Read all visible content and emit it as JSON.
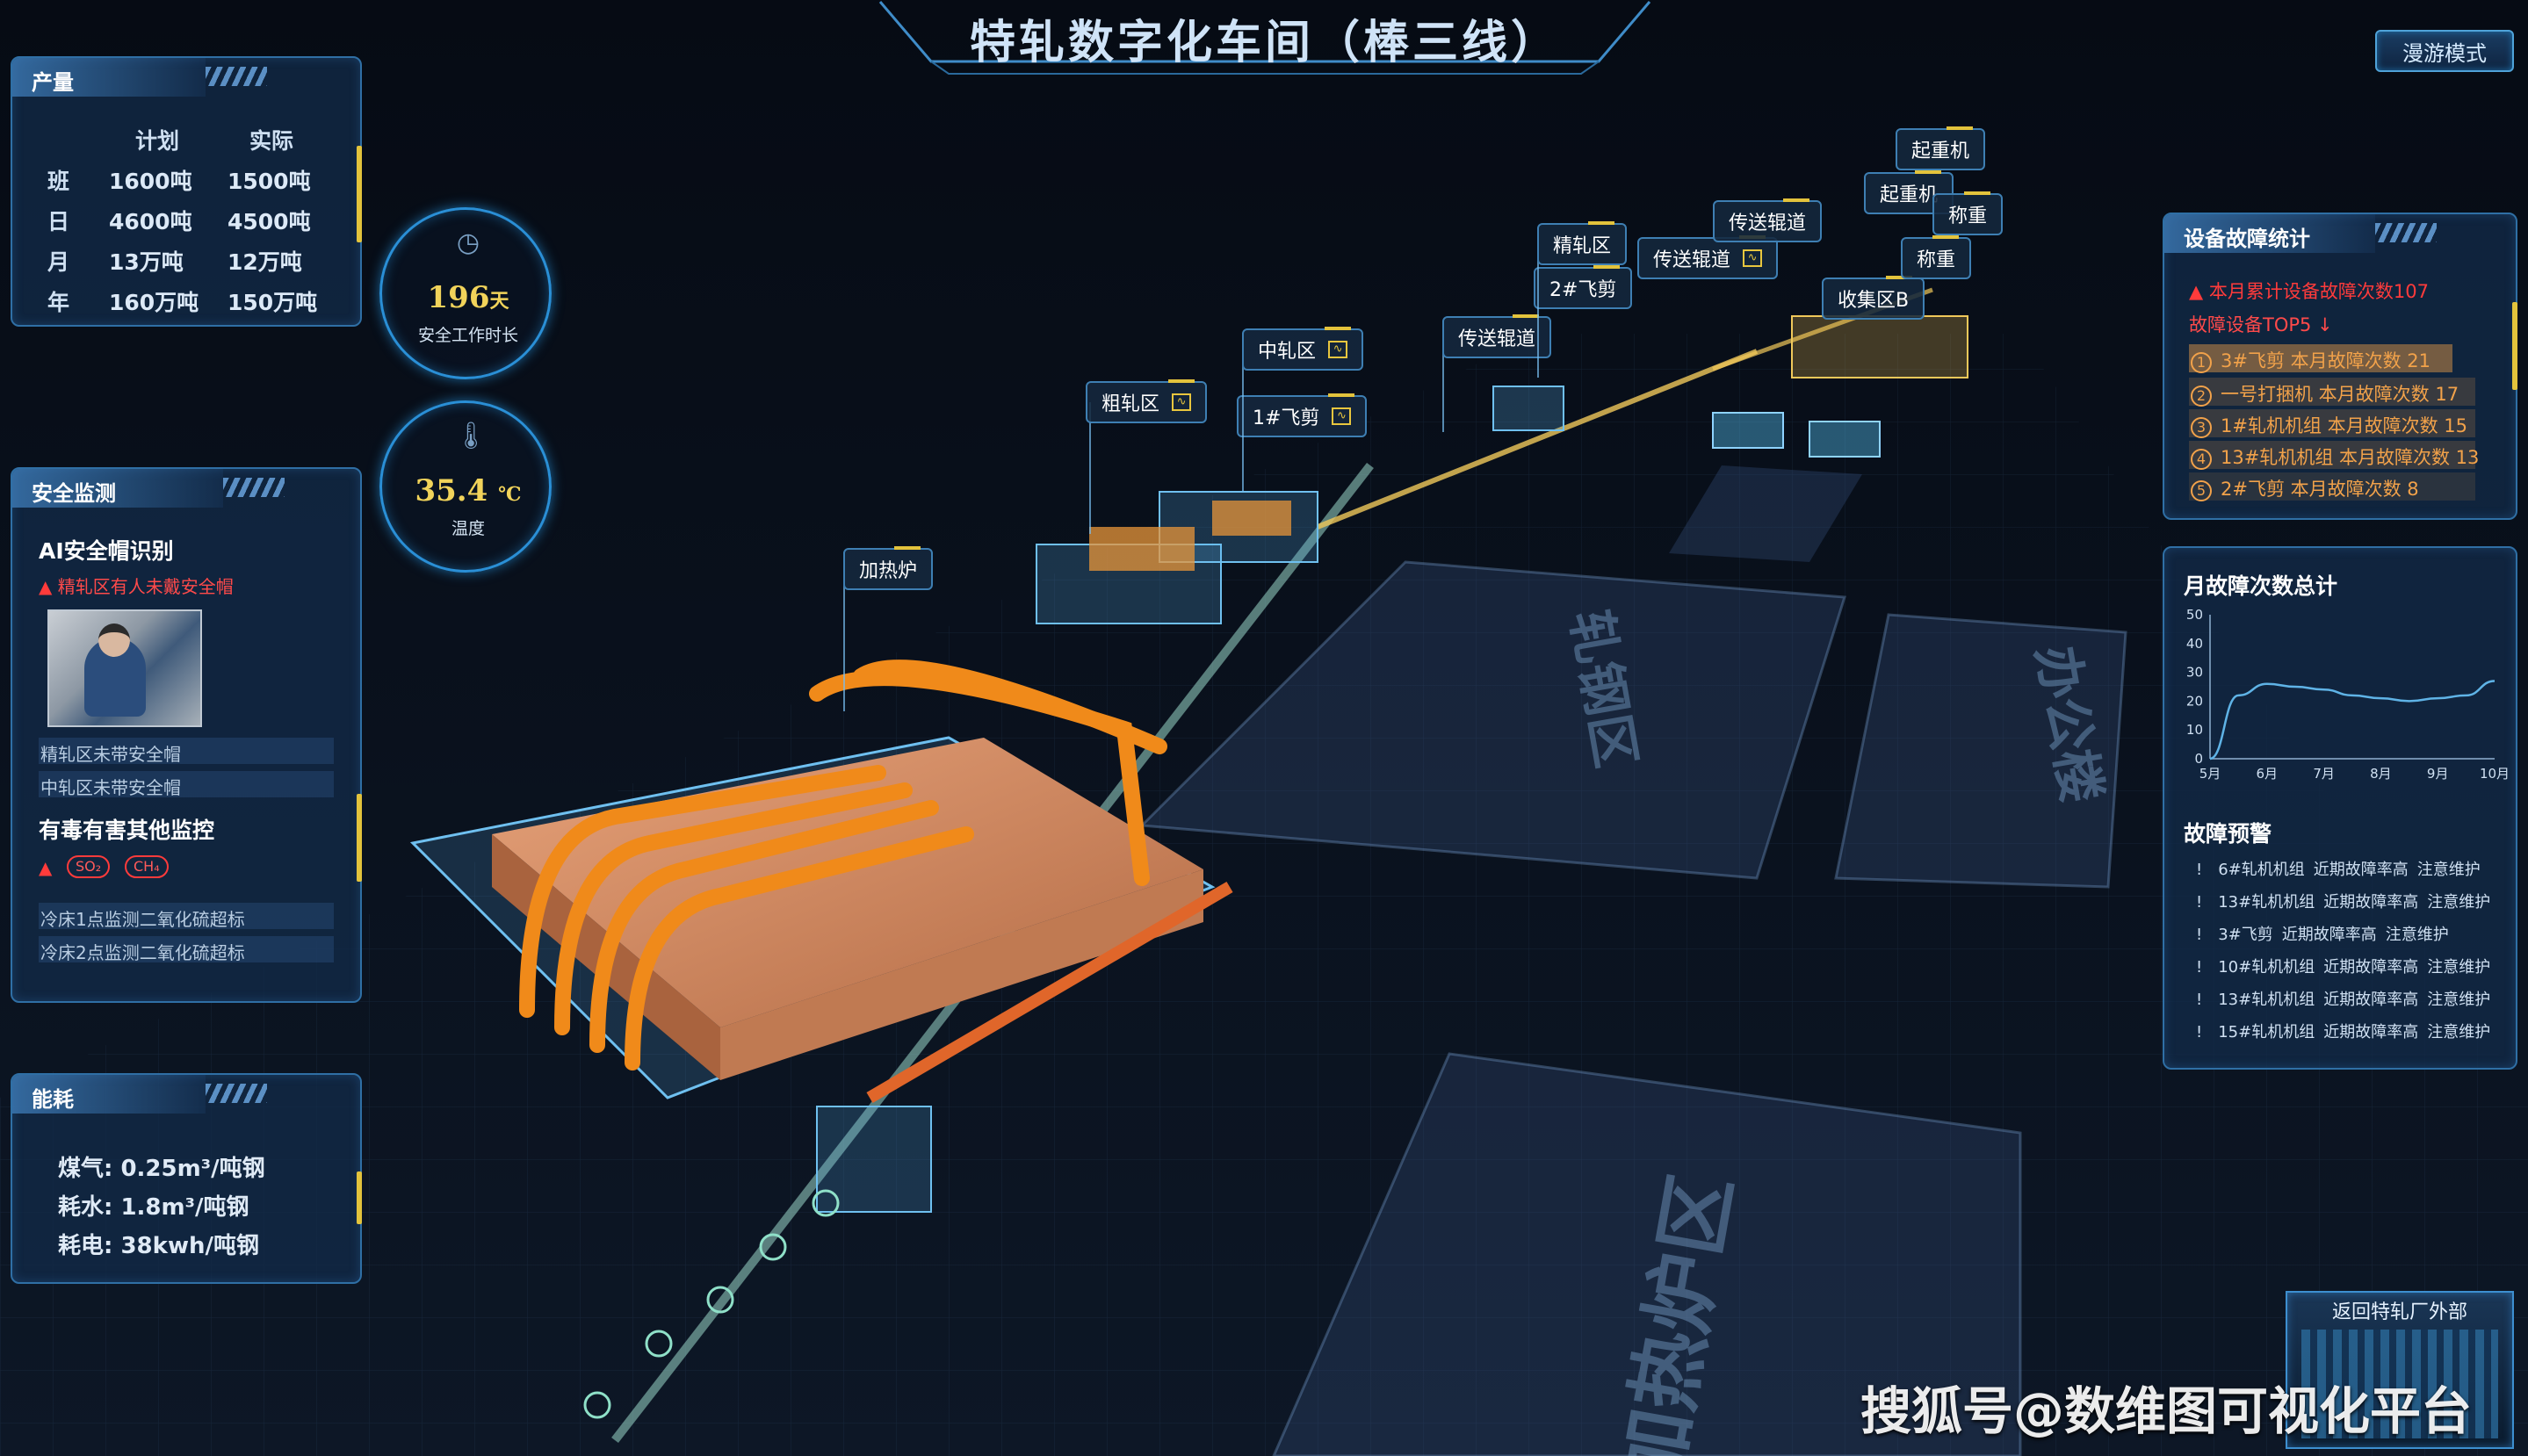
{
  "app": {
    "title": "特轧数字化车间（棒三线）",
    "roam_button": "漫游模式"
  },
  "production": {
    "title": "产量",
    "columns": [
      "",
      "计划",
      "实际"
    ],
    "rows": [
      {
        "period": "班",
        "plan": "1600吨",
        "actual": "1500吨"
      },
      {
        "period": "日",
        "plan": "4600吨",
        "actual": "4500吨"
      },
      {
        "period": "月",
        "plan": "13万吨",
        "actual": "12万吨"
      },
      {
        "period": "年",
        "plan": "160万吨",
        "actual": "150万吨"
      }
    ]
  },
  "gauges": {
    "work_days": {
      "value": "196",
      "unit": "天",
      "label": "安全工作时长",
      "icon": "clock-icon"
    },
    "temperature": {
      "value": "35.4",
      "unit": "℃",
      "label": "温度",
      "icon": "thermometer-icon"
    }
  },
  "safety": {
    "title": "安全监测",
    "ai_title": "AI安全帽识别",
    "ai_alert": "精轧区有人未戴安全帽",
    "ai_logs": [
      "精轧区未带安全帽",
      "中轧区未带安全帽"
    ],
    "gas_title": "有毒有害其他监控",
    "gas_chips": [
      "SO₂",
      "CH₄"
    ],
    "gas_logs": [
      "冷床1点监测二氧化硫超标",
      "冷床2点监测二氧化硫超标"
    ]
  },
  "energy": {
    "title": "能耗",
    "items": [
      {
        "label": "煤气:",
        "value": "0.25m³/吨钢"
      },
      {
        "label": "耗水:",
        "value": "1.8m³/吨钢"
      },
      {
        "label": "耗电:",
        "value": "38kwh/吨钢"
      }
    ]
  },
  "faults": {
    "title": "设备故障统计",
    "total": "本月累计设备故障次数107",
    "top5_title": "故障设备TOP5 ↓",
    "top5": [
      {
        "rank": "1",
        "text": "3#飞剪 本月故障次数 21"
      },
      {
        "rank": "2",
        "text": "一号打捆机 本月故障次数 17"
      },
      {
        "rank": "3",
        "text": "1#轧机机组 本月故障次数 15"
      },
      {
        "rank": "4",
        "text": "13#轧机机组 本月故障次数 13"
      },
      {
        "rank": "5",
        "text": "2#飞剪 本月故障次数 8"
      }
    ]
  },
  "chart_data": {
    "type": "line",
    "title": "月故障次数总计",
    "categories": [
      "5月",
      "6月",
      "7月",
      "8月",
      "9月",
      "10月"
    ],
    "x": [
      5,
      5.5,
      6,
      6.5,
      7,
      7.5,
      8,
      8.5,
      9,
      9.5,
      10
    ],
    "values": [
      0,
      22,
      26,
      25,
      24,
      22,
      21,
      20,
      21,
      22,
      27
    ],
    "yticks": [
      "0",
      "10",
      "20",
      "30",
      "40",
      "50"
    ],
    "ylim": [
      0,
      50
    ],
    "grid": false,
    "line_color": "#5fb3e6"
  },
  "warnings": {
    "title": "故障预警",
    "items": [
      {
        "device": "6#轧机机组",
        "status": "近期故障率高",
        "action": "注意维护"
      },
      {
        "device": "13#轧机机组",
        "status": "近期故障率高",
        "action": "注意维护"
      },
      {
        "device": "3#飞剪",
        "status": "近期故障率高",
        "action": "注意维护"
      },
      {
        "device": "10#轧机机组",
        "status": "近期故障率高",
        "action": "注意维护"
      },
      {
        "device": "13#轧机机组",
        "status": "近期故障率高",
        "action": "注意维护"
      },
      {
        "device": "15#轧机机组",
        "status": "近期故障率高",
        "action": "注意维护"
      }
    ]
  },
  "return_button": "返回特轧厂外部",
  "watermark": "搜狐号@数维图可视化平台",
  "stations": [
    {
      "name": "加热炉"
    },
    {
      "name": "粗轧区"
    },
    {
      "name": "1#飞剪"
    },
    {
      "name": "中轧区"
    },
    {
      "name": "传送辊道"
    },
    {
      "name": "2#飞剪"
    },
    {
      "name": "精轧区"
    },
    {
      "name": "传送辊道"
    },
    {
      "name": "传送辊道"
    },
    {
      "name": "收集区B"
    },
    {
      "name": "称重"
    },
    {
      "name": "起重机"
    },
    {
      "name": "称重"
    },
    {
      "name": "起重机"
    }
  ],
  "floor_labels": [
    "轧钢区",
    "办公楼",
    "加热炉区"
  ],
  "colors": {
    "accent": "#2f6fa5",
    "alert": "#ff3b3b",
    "highlight": "#f1d35a",
    "warning": "#f2a24a"
  }
}
